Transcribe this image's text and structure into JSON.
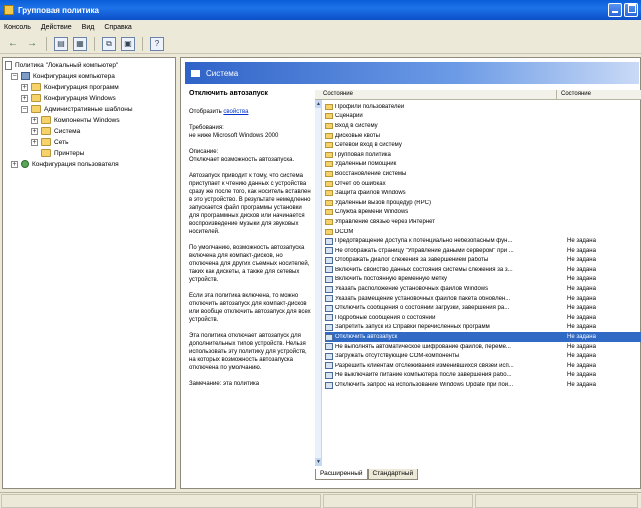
{
  "window": {
    "title": "Групповая политика"
  },
  "menu": [
    "Консоль",
    "Действие",
    "Вид",
    "Справка"
  ],
  "tree": [
    {
      "label": "Политика \"Локальный компьютер\"",
      "kind": "doc",
      "indent": 0
    },
    {
      "label": "Конфигурация компьютера",
      "kind": "pc",
      "indent": 1,
      "expander": "−"
    },
    {
      "label": "Конфигурация программ",
      "kind": "folder",
      "indent": 2,
      "expander": "+"
    },
    {
      "label": "Конфигурация Windows",
      "kind": "folder",
      "indent": 2,
      "expander": "+"
    },
    {
      "label": "Административные шаблоны",
      "kind": "folder",
      "indent": 2,
      "expander": "−"
    },
    {
      "label": "Компоненты Windows",
      "kind": "folder",
      "indent": 3,
      "expander": "+"
    },
    {
      "label": "Система",
      "kind": "folder",
      "indent": 3,
      "expander": "+"
    },
    {
      "label": "Сеть",
      "kind": "folder",
      "indent": 3,
      "expander": "+"
    },
    {
      "label": "Принтеры",
      "kind": "folder",
      "indent": 3
    },
    {
      "label": "Конфигурация пользователя",
      "kind": "user",
      "indent": 0,
      "expander": "+"
    }
  ],
  "banner": {
    "title": "Система"
  },
  "description": {
    "heading": "Отключить автозапуск",
    "show_label": "Отобразить",
    "show_link": "свойства",
    "requirements": "Требования:\nне ниже Microsoft Windows 2000",
    "description_label": "Описание:\nОтключает возможность автозапуска.",
    "p1": "Автозапуск приводит к тому, что система приступает к чтению данных с устройства сразу же после того, как носитель вставлен в это устройство. В результате немедленно запускается файл программы установки для программных дисков или начинается воспроизведение музыки для звуковых носителей.",
    "p2": "По умолчанию, возможность автозапуска включена для компакт-дисков, но отключена для других съемных носителей, таких как дискеты, а также для сетевых устройств.",
    "p3": "Если эта политика включена, то можно отключить автозапуск для компакт-дисков или вообще отключить автозапуск для всех устройств.",
    "p4": "Эта политика отключает автозапуск для дополнительных типов устройств. Нельзя использовать эту политику для устройств, на которых возможность автозапуска отключена по умолчанию.",
    "p5": "Замечание: эта политика"
  },
  "listview": {
    "col_setting": "Состояние",
    "col_state": "Состояние",
    "folders": [
      "Профили пользователей",
      "Сценарии",
      "Вход в систему",
      "Дисковые квоты",
      "Сетевой вход в систему",
      "Групповая политика",
      "Удаленный помощник",
      "Восстановление системы",
      "Отчет об ошибках",
      "Защита файлов Windows",
      "Удаленный вызов процедур (RPC)",
      "Служба времени Windows",
      "Управление связью через Интернет",
      "DCOM"
    ],
    "policies": [
      {
        "name": "Предотвращение доступа к потенциально небезопасным фун...",
        "state": "Не задана"
      },
      {
        "name": "Не отображать страницу \"Управление даными сервером\" при ...",
        "state": "Не задана"
      },
      {
        "name": "Отображать диалог слежения за завершением работы",
        "state": "Не задана"
      },
      {
        "name": "Включить свойство данных состояния системы слежения за з...",
        "state": "Не задана"
      },
      {
        "name": "Включить постоянную временную метку",
        "state": "Не задана"
      },
      {
        "name": "Указать расположение установочных файлов Windows",
        "state": "Не задана"
      },
      {
        "name": "Указать размещение установочных файлов пакета обновлен...",
        "state": "Не задана"
      },
      {
        "name": "Отключить сообщения о состоянии загрузки, завершения ра...",
        "state": "Не задана"
      },
      {
        "name": "Подробные сообщения о состоянии",
        "state": "Не задана"
      },
      {
        "name": "Запретить запуск из Справки перечисленных программ",
        "state": "Не задана"
      },
      {
        "name": "Отключить автозапуск",
        "state": "Не задана",
        "selected": true
      },
      {
        "name": "Не выполнять автоматическое шифрование файлов, переме...",
        "state": "Не задана"
      },
      {
        "name": "Загружать отсутствующие COM-компоненты",
        "state": "Не задана"
      },
      {
        "name": "Разрешить клиентам отслеживания изменившихся связей исп...",
        "state": "Не задана"
      },
      {
        "name": "Не выключайте питание компьютера после завершения рабо...",
        "state": "Не задана"
      },
      {
        "name": "Отключить запрос на использование Windows Update при пои...",
        "state": "Не задана"
      }
    ]
  },
  "tabs": [
    "Расширенный",
    "Стандартный"
  ]
}
